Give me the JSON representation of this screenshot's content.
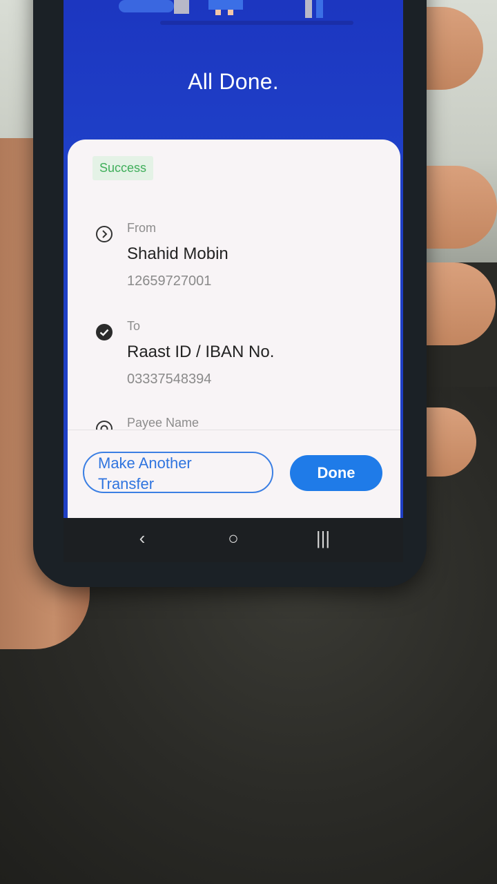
{
  "screen": {
    "heading": "All Done.",
    "status_badge": "Success",
    "from": {
      "label": "From",
      "name": "Shahid Mobin",
      "account": "12659727001",
      "icon": "chevron-right-circle-icon"
    },
    "to": {
      "label": "To",
      "name": "Raast ID / IBAN No.",
      "account": "03337548394",
      "icon": "check-circle-icon"
    },
    "payee": {
      "label": "Payee Name",
      "icon": "target-icon"
    },
    "buttons": {
      "another_line1": "Make Another",
      "another_line2": "Transfer",
      "done": "Done"
    }
  },
  "nav": {
    "back_glyph": "‹",
    "home_glyph": "○",
    "recents_glyph": "|||",
    "icons": [
      "back-icon",
      "home-icon",
      "recents-icon"
    ]
  },
  "colors": {
    "hero_blue": "#1f40c8",
    "accent_blue": "#1f7be8",
    "success_green": "#3fae5a"
  }
}
